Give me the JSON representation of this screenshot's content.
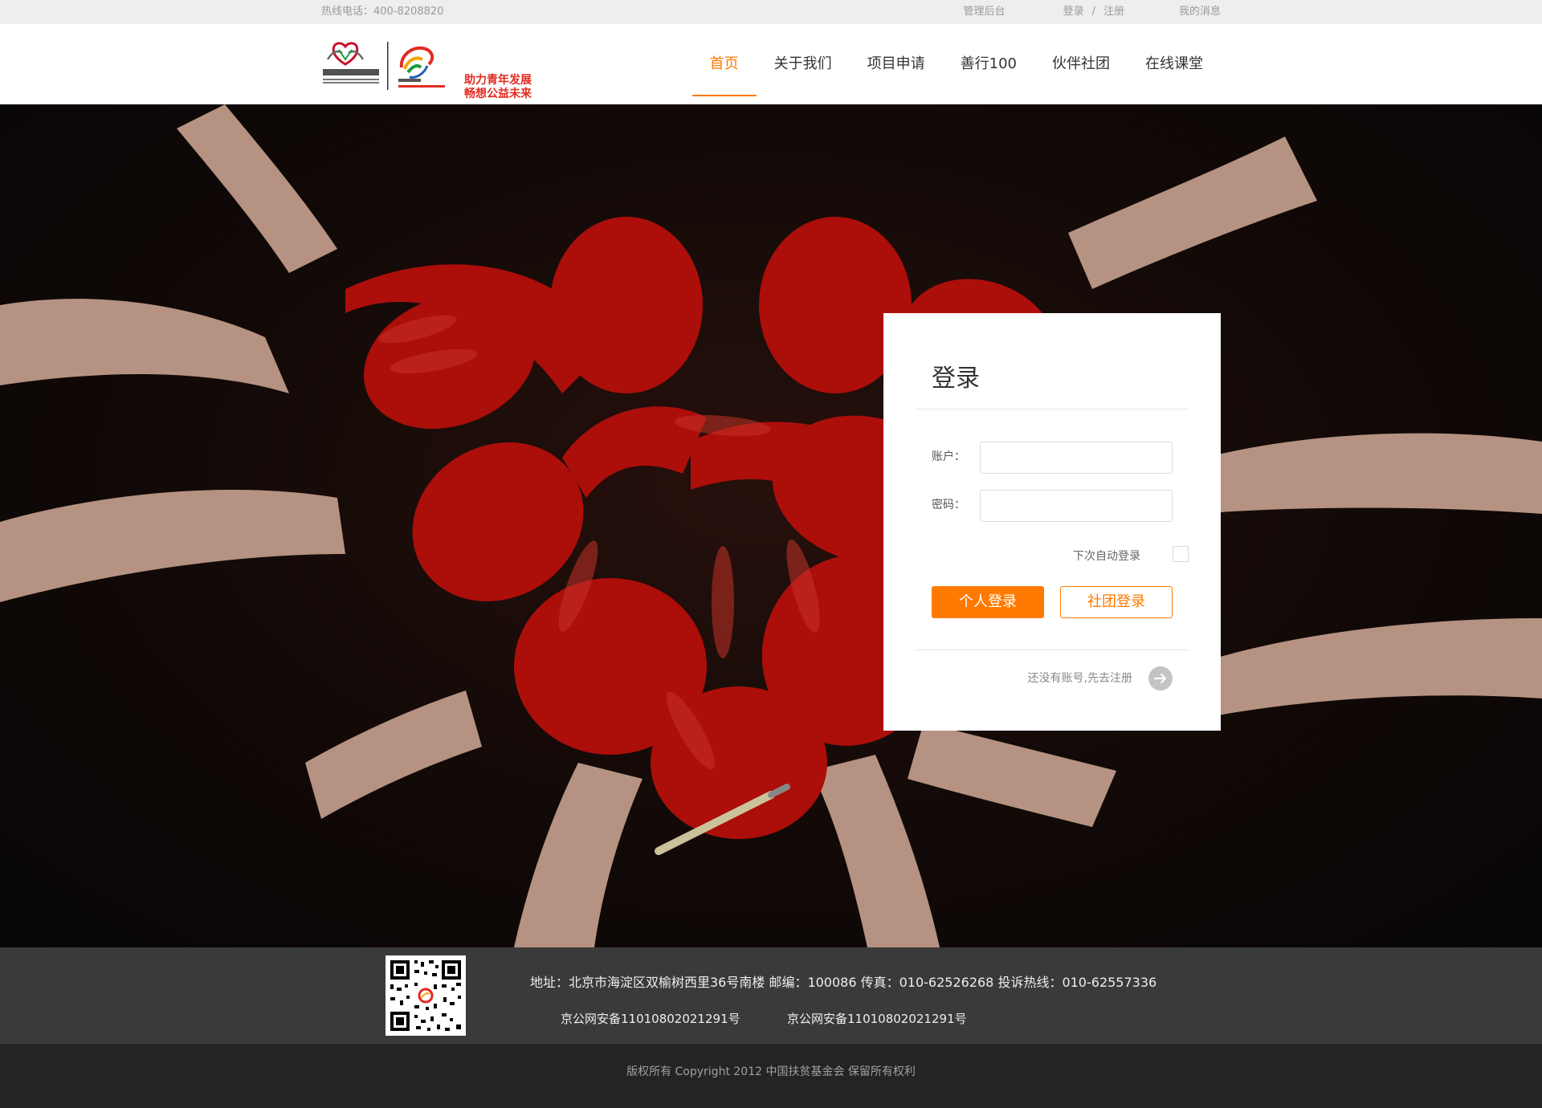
{
  "topbar": {
    "hotline": "热线电话：400-8208820",
    "admin": "管理后台",
    "login": "登录",
    "separator": "/",
    "register": "注册",
    "messages": "我的消息"
  },
  "logo": {
    "slogan_line1": "助力青年发展",
    "slogan_line2": "畅想公益未来"
  },
  "nav": {
    "items": [
      "首页",
      "关于我们",
      "项目申请",
      "善行100",
      "伙伴社团",
      "在线课堂"
    ],
    "active_index": 0
  },
  "login_card": {
    "title": "登录",
    "account_label": "账户：",
    "account_value": "",
    "password_label": "密码：",
    "password_value": "",
    "remember_label": "下次自动登录",
    "remember_checked": false,
    "personal_login": "个人登录",
    "group_login": "社团登录",
    "register_prompt": "还没有账号,先去注册"
  },
  "footer": {
    "address": "地址：北京市海淀区双榆树西里36号南楼 邮编：100086 传真：010-62526268 投诉热线：010-62557336",
    "icp1": "京公网安备11010802021291号",
    "icp2": "京公网安备11010802021291号",
    "copyright": "版权所有 Copyright 2012 中国扶贫基金会 保留所有权利"
  },
  "colors": {
    "accent": "#ff7a00",
    "brand_red": "#e12b20",
    "paint_red": "#c4110c",
    "skin": "#e0b9a3"
  },
  "icons": {
    "register_arrow": "arrow-right-icon",
    "qr_code": "qr-code-icon"
  }
}
